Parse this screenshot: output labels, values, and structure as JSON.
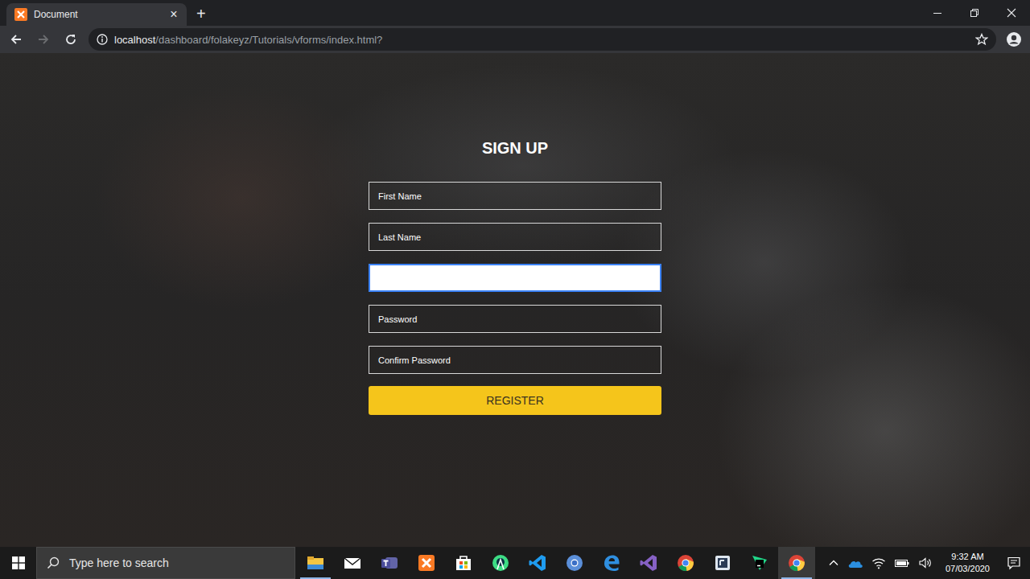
{
  "window": {
    "title": "Document",
    "close_tab": "×",
    "new_tab": "+"
  },
  "address_bar": {
    "host": "localhost",
    "path": "/dashboard/folakeyz/Tutorials/vforms/index.html?"
  },
  "form": {
    "title": "SIGN UP",
    "fields": [
      {
        "placeholder": "First Name",
        "focused": false
      },
      {
        "placeholder": "Last Name",
        "focused": false
      },
      {
        "placeholder": "",
        "focused": true
      },
      {
        "placeholder": "Password",
        "focused": false
      },
      {
        "placeholder": "Confirm Password",
        "focused": false
      }
    ],
    "button": "REGISTER"
  },
  "taskbar": {
    "search": {
      "placeholder": "Type here to search"
    },
    "apps": [
      {
        "running": true,
        "selected": false
      },
      {
        "running": false,
        "selected": false
      },
      {
        "running": false,
        "selected": false
      },
      {
        "running": false,
        "selected": false
      },
      {
        "running": false,
        "selected": false
      },
      {
        "running": false,
        "selected": false
      },
      {
        "running": false,
        "selected": false
      },
      {
        "running": false,
        "selected": false
      },
      {
        "running": false,
        "selected": false
      },
      {
        "running": false,
        "selected": false
      },
      {
        "running": false,
        "selected": false
      },
      {
        "running": false,
        "selected": false
      },
      {
        "running": false,
        "selected": false
      },
      {
        "running": true,
        "selected": true
      }
    ],
    "clock": {
      "time": "9:32 AM",
      "date": "07/03/2020"
    }
  }
}
